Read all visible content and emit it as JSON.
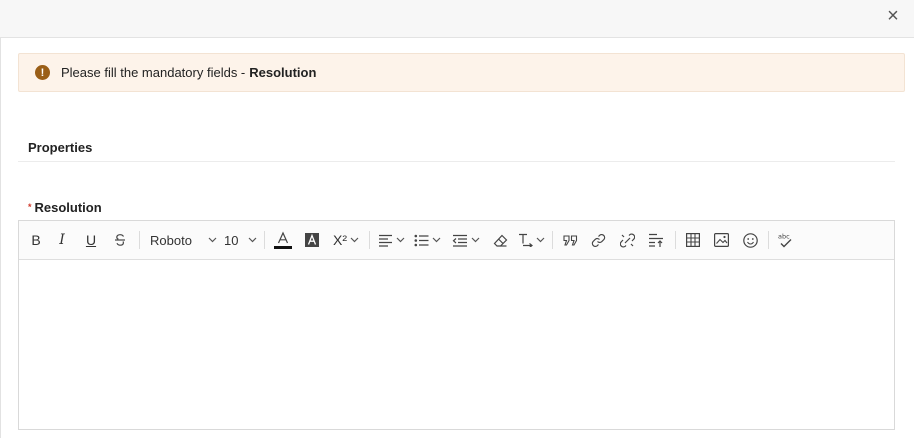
{
  "dialog": {
    "close_glyph": "×"
  },
  "alert": {
    "message": "Please fill the mandatory fields - ",
    "field": "Resolution",
    "icon": "exclamation-icon",
    "color": "#9a5e17",
    "background": "#fdf3ea"
  },
  "section": {
    "title": "Properties"
  },
  "field": {
    "required_mark": "*",
    "label": "Resolution"
  },
  "toolbar": {
    "bold": "B",
    "italic": "I",
    "underline": "U",
    "font_family": "Roboto",
    "font_size": "10",
    "superscript": "X²"
  }
}
